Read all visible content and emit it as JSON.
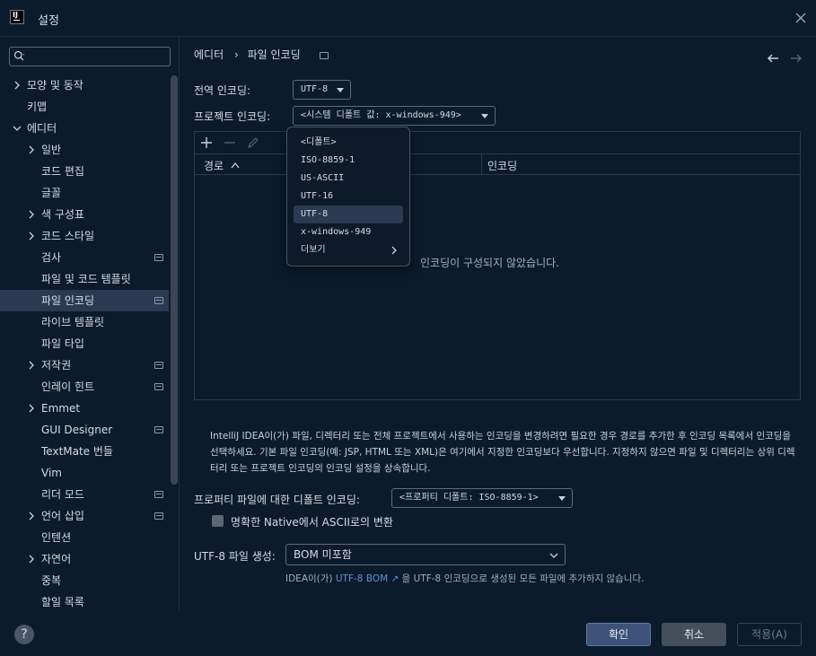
{
  "window": {
    "title": "설정",
    "logo_text": "IJ"
  },
  "sidebar": {
    "search_placeholder": "",
    "items": [
      {
        "label": "모양 및 동작",
        "level": 0,
        "chevron": "right"
      },
      {
        "label": "키맵",
        "level": 0
      },
      {
        "label": "에디터",
        "level": 0,
        "chevron": "down"
      },
      {
        "label": "일반",
        "level": 1,
        "chevron": "right"
      },
      {
        "label": "코드 편집",
        "level": 1
      },
      {
        "label": "글꼴",
        "level": 1
      },
      {
        "label": "색 구성표",
        "level": 1,
        "chevron": "right"
      },
      {
        "label": "코드 스타일",
        "level": 1,
        "chevron": "right"
      },
      {
        "label": "검사",
        "level": 1,
        "pin": true
      },
      {
        "label": "파일 및 코드 템플릿",
        "level": 1
      },
      {
        "label": "파일 인코딩",
        "level": 1,
        "pin": true,
        "selected": true
      },
      {
        "label": "라이브 템플릿",
        "level": 1
      },
      {
        "label": "파일 타입",
        "level": 1
      },
      {
        "label": "저작권",
        "level": 1,
        "chevron": "right",
        "pin": true
      },
      {
        "label": "인레이 힌트",
        "level": 1,
        "pin": true
      },
      {
        "label": "Emmet",
        "level": 1,
        "chevron": "right"
      },
      {
        "label": "GUI Designer",
        "level": 1,
        "pin": true
      },
      {
        "label": "TextMate 번들",
        "level": 1
      },
      {
        "label": "Vim",
        "level": 1
      },
      {
        "label": "리더 모드",
        "level": 1,
        "pin": true
      },
      {
        "label": "언어 삽입",
        "level": 1,
        "chevron": "right",
        "pin": true
      },
      {
        "label": "인텐션",
        "level": 1
      },
      {
        "label": "자연어",
        "level": 1,
        "chevron": "right"
      },
      {
        "label": "중복",
        "level": 1
      },
      {
        "label": "할일 목록",
        "level": 1
      }
    ]
  },
  "breadcrumb": {
    "parent": "에디터",
    "separator": "›",
    "current": "파일 인코딩"
  },
  "global_encoding": {
    "label": "전역 인코딩:",
    "value": "UTF-8"
  },
  "project_encoding": {
    "label": "프로젝트 인코딩:",
    "value": "<시스템 디폴트 값: x-windows-949>"
  },
  "table": {
    "columns": [
      "경로",
      "인코딩"
    ],
    "empty_text": "인코딩이 구성되지 않았습니다."
  },
  "dropdown": {
    "items": [
      {
        "label": "<디폴트>"
      },
      {
        "label": "ISO-8859-1"
      },
      {
        "label": "US-ASCII"
      },
      {
        "label": "UTF-16"
      },
      {
        "label": "UTF-8",
        "highlighted": true
      },
      {
        "label": "x-windows-949"
      },
      {
        "label": "더보기",
        "submenu": true
      }
    ]
  },
  "help_text": "IntelliJ IDEA이(가) 파일, 디렉터리 또는 전체 프로젝트에서 사용하는 인코딩을 변경하려면 필요한 경우 경로를 추가한 후 인코딩 목록에서 인코딩을 선택하세요. 기본 파일 인코딩(예: JSP, HTML 또는 XML)은 여기에서 지정한 인코딩보다 우선합니다. 지정하지 않으면 파일 및 디렉터리는 상위 디렉터리 또는 프로젝트 인코딩의 인코딩 설정을 상속합니다.",
  "properties_encoding": {
    "label": "프로퍼티 파일에 대한 디폴트 인코딩:",
    "value": "<프로퍼티 디폴트: ISO-8859-1>"
  },
  "native_to_ascii": {
    "label": "명확한 Native에서 ASCII로의 변환",
    "checked": false
  },
  "utf8_bom": {
    "label": "UTF-8 파일 생성:",
    "value": "BOM 미포함",
    "info_prefix": "IDEA이(가) ",
    "info_link": "UTF-8 BOM ↗",
    "info_suffix": " 을 UTF-8 인코딩으로 생성된 모든 파일에 추가하지 않습니다."
  },
  "buttons": {
    "help": "?",
    "ok": "확인",
    "cancel": "취소",
    "apply": "적용(A)"
  },
  "colors": {
    "background": "#0b1b2b",
    "selection": "#2b3a52",
    "primary_button": "#3c5278",
    "link": "#5d8fdc"
  }
}
